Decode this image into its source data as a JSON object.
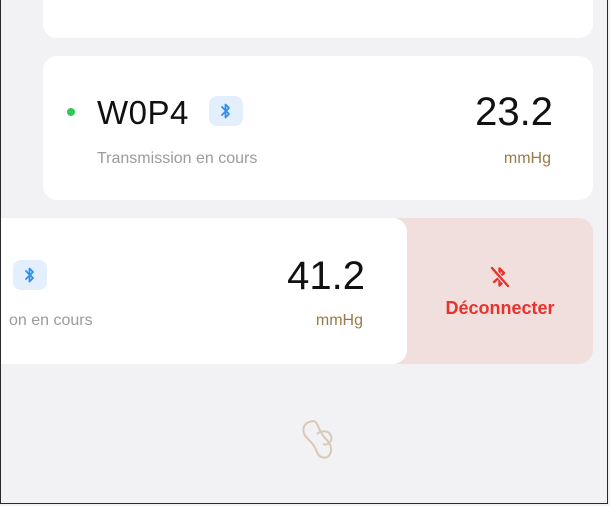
{
  "devices": [
    {
      "name": "W0P4",
      "status": "Transmission en cours",
      "value": "23.2",
      "unit": "mmHg",
      "connected": true
    },
    {
      "status_partial": "on en cours",
      "value": "41.2",
      "unit": "mmHg"
    }
  ],
  "actions": {
    "disconnect_label": "Déconnecter"
  },
  "colors": {
    "status_dot": "#34c759",
    "bluetooth": "#2f8ff0",
    "unit": "#9a7a4a",
    "danger": "#e8322e",
    "danger_bg": "#f0dfdd"
  },
  "icons": {
    "bluetooth": "bluetooth-icon",
    "bluetooth_off": "bluetooth-off-icon",
    "app_logo": "app-logo-icon"
  }
}
